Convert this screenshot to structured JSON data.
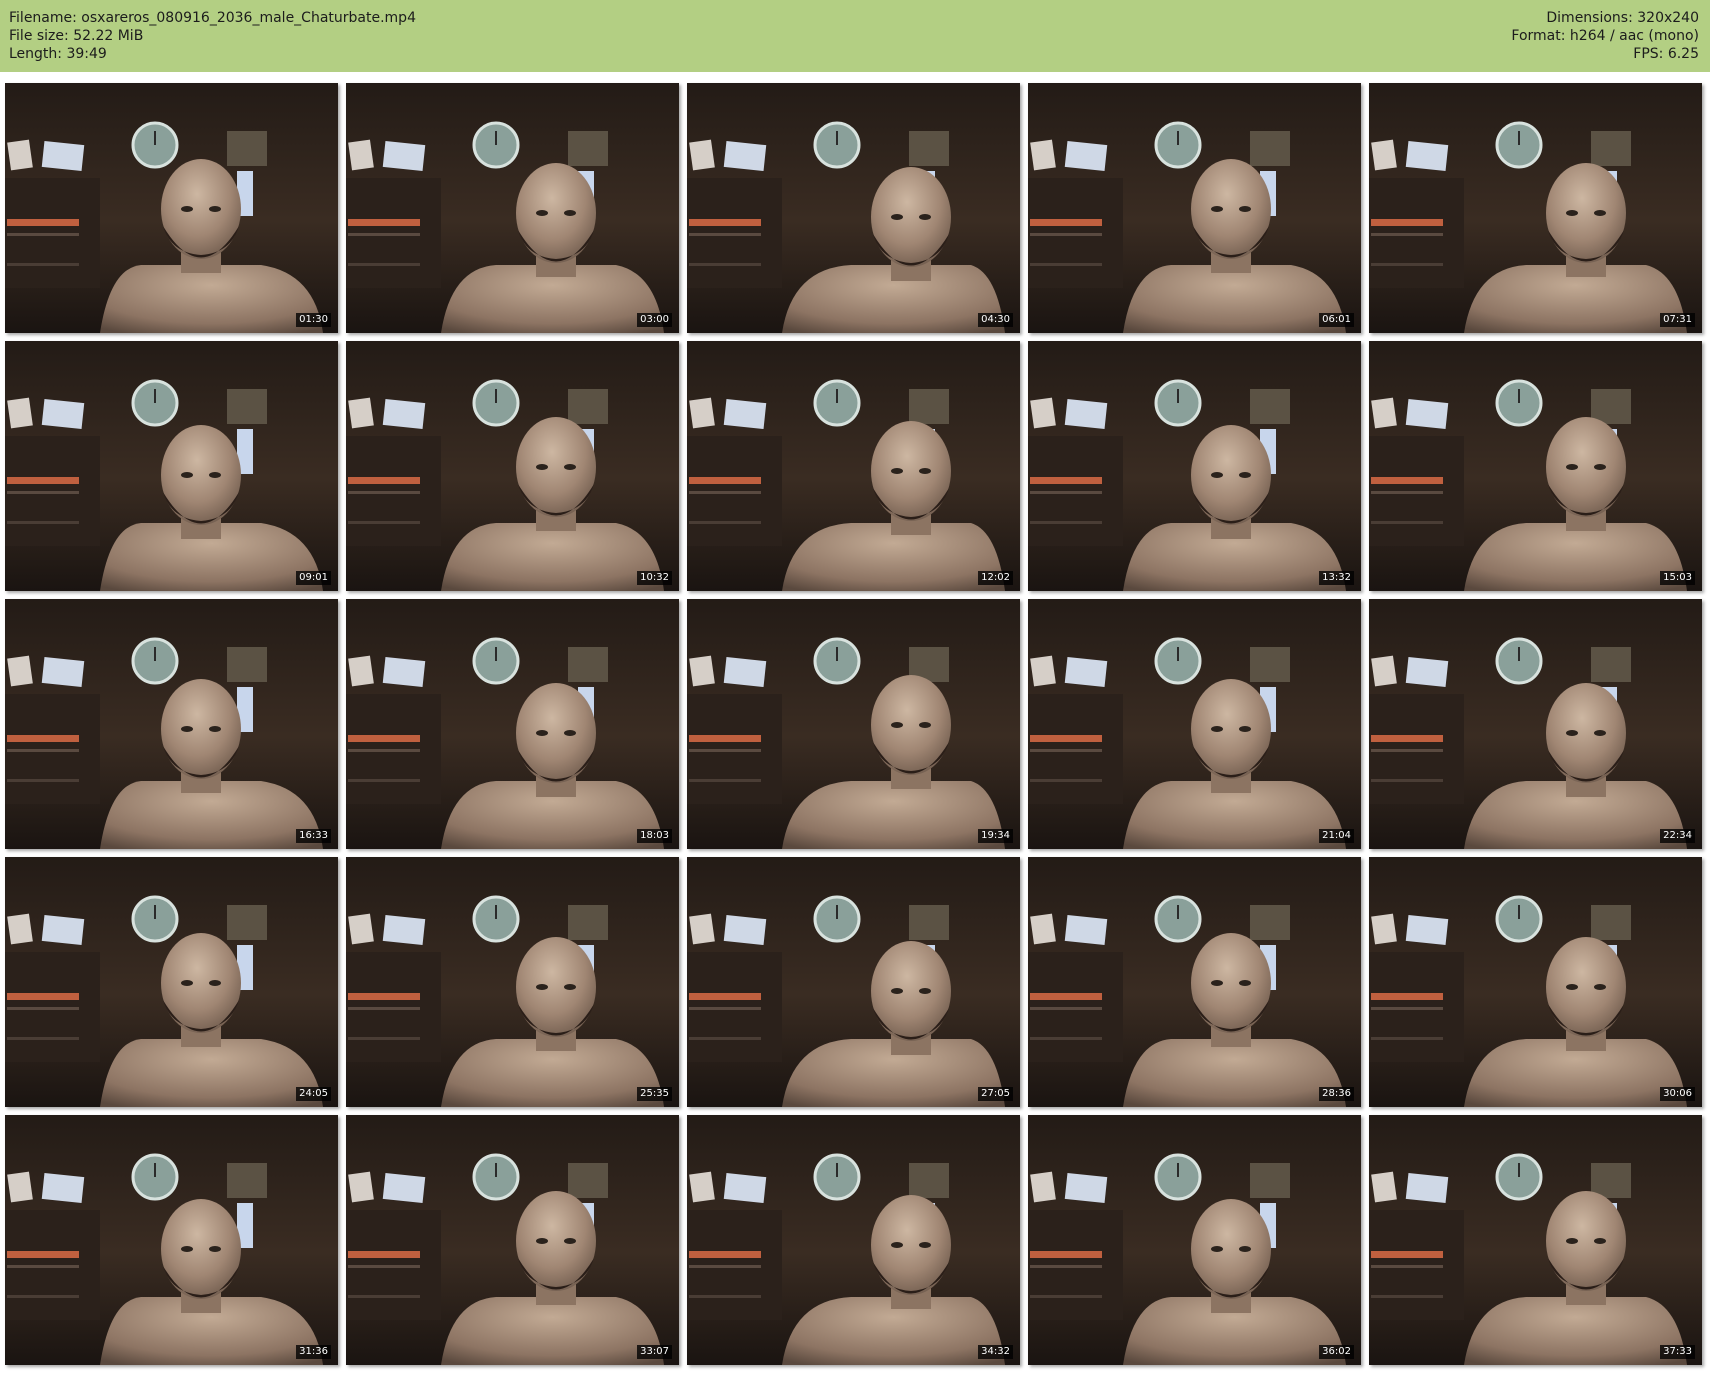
{
  "header": {
    "filename_line": "Filename: osxareros_080916_2036_male_Chaturbate.mp4",
    "filesize_line": "File size: 52.22 MiB",
    "length_line": "Length: 39:49",
    "dimensions_line": "Dimensions: 320x240",
    "format_line": "Format: h264 / aac (mono)",
    "fps_line": "FPS: 6.25"
  },
  "colors": {
    "header_bg": "#b3cf83",
    "page_bg": "#ffffff",
    "timestamp_bg": "#000000"
  },
  "thumbnails": [
    {
      "time": "01:30"
    },
    {
      "time": "03:00"
    },
    {
      "time": "04:30"
    },
    {
      "time": "06:01"
    },
    {
      "time": "07:31"
    },
    {
      "time": "09:01"
    },
    {
      "time": "10:32"
    },
    {
      "time": "12:02"
    },
    {
      "time": "13:32"
    },
    {
      "time": "15:03"
    },
    {
      "time": "16:33"
    },
    {
      "time": "18:03"
    },
    {
      "time": "19:34"
    },
    {
      "time": "21:04"
    },
    {
      "time": "22:34"
    },
    {
      "time": "24:05"
    },
    {
      "time": "25:35"
    },
    {
      "time": "27:05"
    },
    {
      "time": "28:36"
    },
    {
      "time": "30:06"
    },
    {
      "time": "31:36"
    },
    {
      "time": "33:07"
    },
    {
      "time": "34:32"
    },
    {
      "time": "36:02"
    },
    {
      "time": "37:33"
    }
  ]
}
